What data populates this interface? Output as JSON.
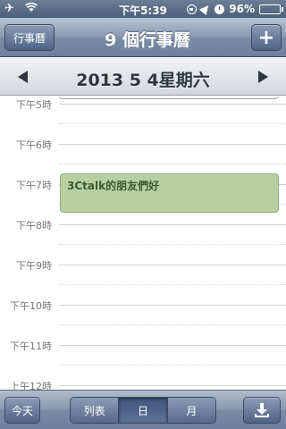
{
  "status_bar": {
    "time": "下午5:39",
    "battery": "96%",
    "battery_level": 0.96
  },
  "nav": {
    "calendars_button": "行事曆",
    "title": "9 個行事曆",
    "add_button": "+"
  },
  "date_header": {
    "date": "2013 5 4星期六"
  },
  "timeline": {
    "hours": [
      "下午5時",
      "下午6時",
      "下午7時",
      "下午8時",
      "下午9時",
      "下午10時",
      "下午11時",
      "上午12時"
    ],
    "event": {
      "title": "3Ctalk的朋友們好"
    }
  },
  "toolbar": {
    "today_button": "今天",
    "segments": [
      "列表",
      "日",
      "月"
    ],
    "selected_segment": "日"
  },
  "colors": {
    "event_fill": "#b8cfa4",
    "nav_bar": "#7b8ca6"
  }
}
